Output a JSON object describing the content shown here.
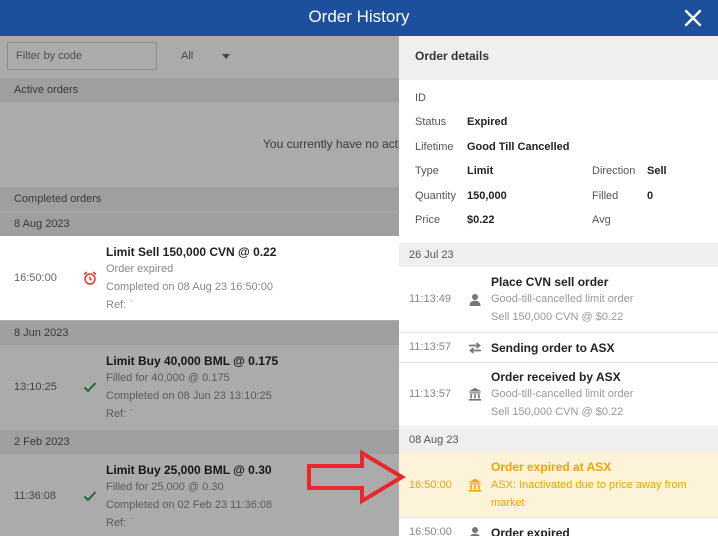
{
  "window": {
    "title": "Order History"
  },
  "filter": {
    "placeholder": "Filter by code",
    "select_value": "All"
  },
  "active": {
    "header": "Active orders",
    "empty_message": "You currently have no activ"
  },
  "completed": {
    "header": "Completed orders",
    "groups": [
      {
        "date": "8 Aug 2023",
        "order": {
          "time": "16:50:00",
          "status_icon": "alarm-clock-icon",
          "title": "Limit Sell 150,000 CVN @ 0.22",
          "line2": "Order expired",
          "line3": "Completed on 08 Aug 23 16:50:00",
          "line4": "Ref: ˈ"
        }
      },
      {
        "date": "8 Jun 2023",
        "order": {
          "time": "13:10:25",
          "status_icon": "checkmark-icon",
          "title": "Limit Buy 40,000 BML @ 0.175",
          "line2": "Filled for 40,000 @ 0.175",
          "line3": "Completed on 08 Jun 23 13:10:25",
          "line4": "Ref: ˈ"
        }
      },
      {
        "date": "2 Feb 2023",
        "order": {
          "time": "11:36:08",
          "status_icon": "checkmark-icon",
          "title": "Limit Buy 25,000 BML @ 0.30",
          "line2": "Filled for 25,000 @ 0.30",
          "line3": "Completed on 02 Feb 23 11:36:08",
          "line4": "Ref: ˈ"
        }
      }
    ]
  },
  "details": {
    "header": "Order details",
    "id_label": "ID",
    "id_value": "",
    "status_label": "Status",
    "status_value": "Expired",
    "lifetime_label": "Lifetime",
    "lifetime_value": "Good Till Cancelled",
    "type_label": "Type",
    "type_value": "Limit",
    "direction_label": "Direction",
    "direction_value": "Sell",
    "quantity_label": "Quantity",
    "quantity_value": "150,000",
    "filled_label": "Filled",
    "filled_value": "0",
    "price_label": "Price",
    "price_value": "$0.22",
    "avg_label": "Avg",
    "avg_value": ""
  },
  "timeline": [
    {
      "date": "26 Jul 23",
      "events": [
        {
          "time": "11:13:49",
          "icon": "user-icon",
          "title": "Place CVN sell order",
          "line2": "Good-till-cancelled limit order",
          "line3": "Sell 150,000 CVN @ $0.22"
        },
        {
          "time": "11:13:57",
          "icon": "transfer-arrows-icon",
          "title": "Sending order to ASX",
          "line2": "",
          "line3": ""
        },
        {
          "time": "11:13:57",
          "icon": "bank-icon",
          "title": "Order received by ASX",
          "line2": "Good-till-cancelled limit order",
          "line3": "Sell 150,000 CVN @ $0.22"
        }
      ]
    },
    {
      "date": "08 Aug 23",
      "events": [
        {
          "time": "16:50:00",
          "icon": "bank-icon",
          "title": "Order expired at ASX",
          "line2": "ASX: Inactivated due to price away from",
          "line3": "market"
        },
        {
          "time": "16:50:00",
          "icon": "user-icon",
          "title": "Order expired",
          "line2": "",
          "line3": ""
        }
      ]
    }
  ],
  "colors": {
    "titlebar": "#1c4f9c",
    "highlight_bg": "#fdf3d8",
    "highlight_text": "#f0a400",
    "success": "#2e9e4f",
    "alert": "#e0372b",
    "annotation": "#e8262b"
  }
}
